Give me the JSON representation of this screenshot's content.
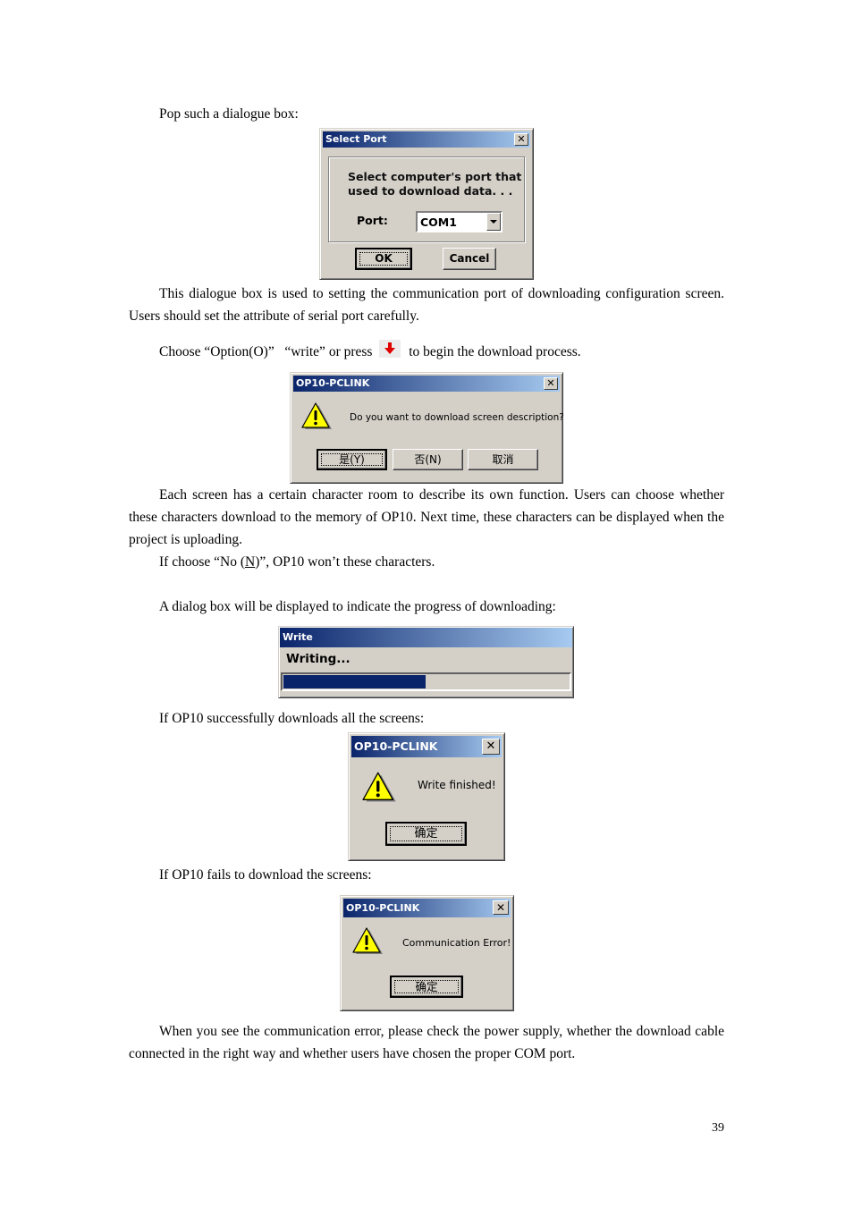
{
  "page": {
    "para_pop": "Pop such a dialogue box:",
    "para_select_port_desc": "This dialogue box is used to setting the communication port of downloading configuration screen. Users should set the attribute of serial port carefully.",
    "para_choose_before": "Choose “Option(O)”   “write” or press",
    "para_choose_after": "to begin the download process.",
    "para_each_screen": "Each screen has a certain character room to describe its own function. Users can choose whether these characters download to the memory of OP10. Next time, these characters can be displayed when the project is uploading.",
    "para_if_no_before": "If choose “No (",
    "para_if_no_key": "N",
    "para_if_no_after": ")”, OP10 won’t these characters.",
    "para_progress": "A dialog box will be displayed to indicate the progress of downloading:",
    "para_success": "If OP10 successfully downloads all the screens:",
    "para_fail": "If OP10 fails to download the screens:",
    "para_error_help": "When you see the communication error, please check the power supply, whether the download cable connected in the right way and whether users have chosen the proper COM port.",
    "page_number": "39",
    "write_icon": "red-down-arrow-icon"
  },
  "dialogs": {
    "select_port": {
      "title": "Select Port",
      "message_line1": "Select computer's port that",
      "message_line2": "used to download data. . .",
      "port_label": "Port:",
      "port_value": "COM1",
      "ok_label": "OK",
      "cancel_label": "Cancel"
    },
    "confirm_download": {
      "title": "OP10-PCLINK",
      "icon": "warning-icon",
      "message": "Do you want to download screen description?",
      "yes_label": "是(Y)",
      "no_label": "否(N)",
      "cancel_label": "取消"
    },
    "write_progress": {
      "title": "Write",
      "status": "Writing...",
      "progress_percent": 50
    },
    "write_finished": {
      "title": "OP10-PCLINK",
      "icon": "warning-icon",
      "message": "Write finished!",
      "ok_label": "确定"
    },
    "comm_error": {
      "title": "OP10-PCLINK",
      "icon": "warning-icon",
      "message": "Communication Error!",
      "ok_label": "确定"
    }
  },
  "colors": {
    "title_gradient_start": "#0a246a",
    "title_gradient_end": "#a6caf0",
    "dialog_face": "#d4d0c8",
    "progress_fill": "#0a246a",
    "arrow_red": "#e00000",
    "warning_yellow": "#ffff00"
  }
}
